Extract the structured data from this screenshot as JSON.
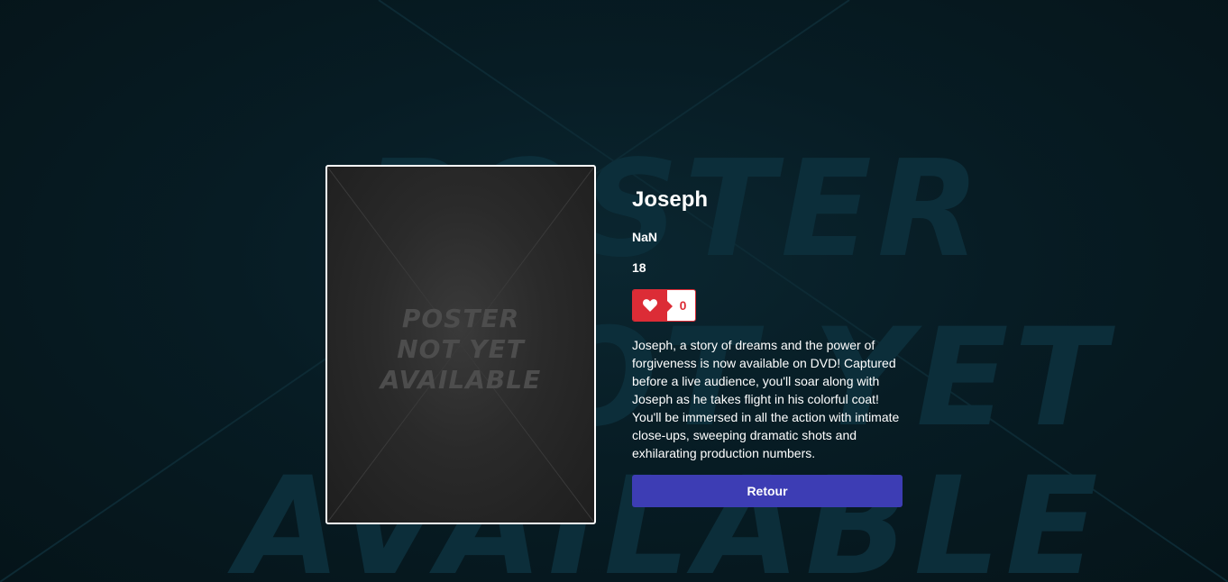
{
  "background": {
    "words": [
      "POSTER",
      "NOT YET",
      "AVAILABLE"
    ]
  },
  "poster": {
    "lines": [
      "POSTER",
      "NOT YET",
      "AVAILABLE"
    ]
  },
  "movie": {
    "title": "Joseph",
    "release": "NaN",
    "rating": "18",
    "likes": "0",
    "description": "Joseph, a story of dreams and the power of forgiveness is now available on DVD! Captured before a live audience, you'll soar along with Joseph as he takes flight in his colorful coat! You'll be immersed in all the action with intimate close-ups, sweeping dramatic shots and exhilarating production numbers."
  },
  "actions": {
    "back_label": "Retour"
  },
  "colors": {
    "background": "#061820",
    "like_accent": "#dc2c36",
    "button_primary": "#3d3db4"
  },
  "icons": {
    "like": "heart-icon"
  }
}
